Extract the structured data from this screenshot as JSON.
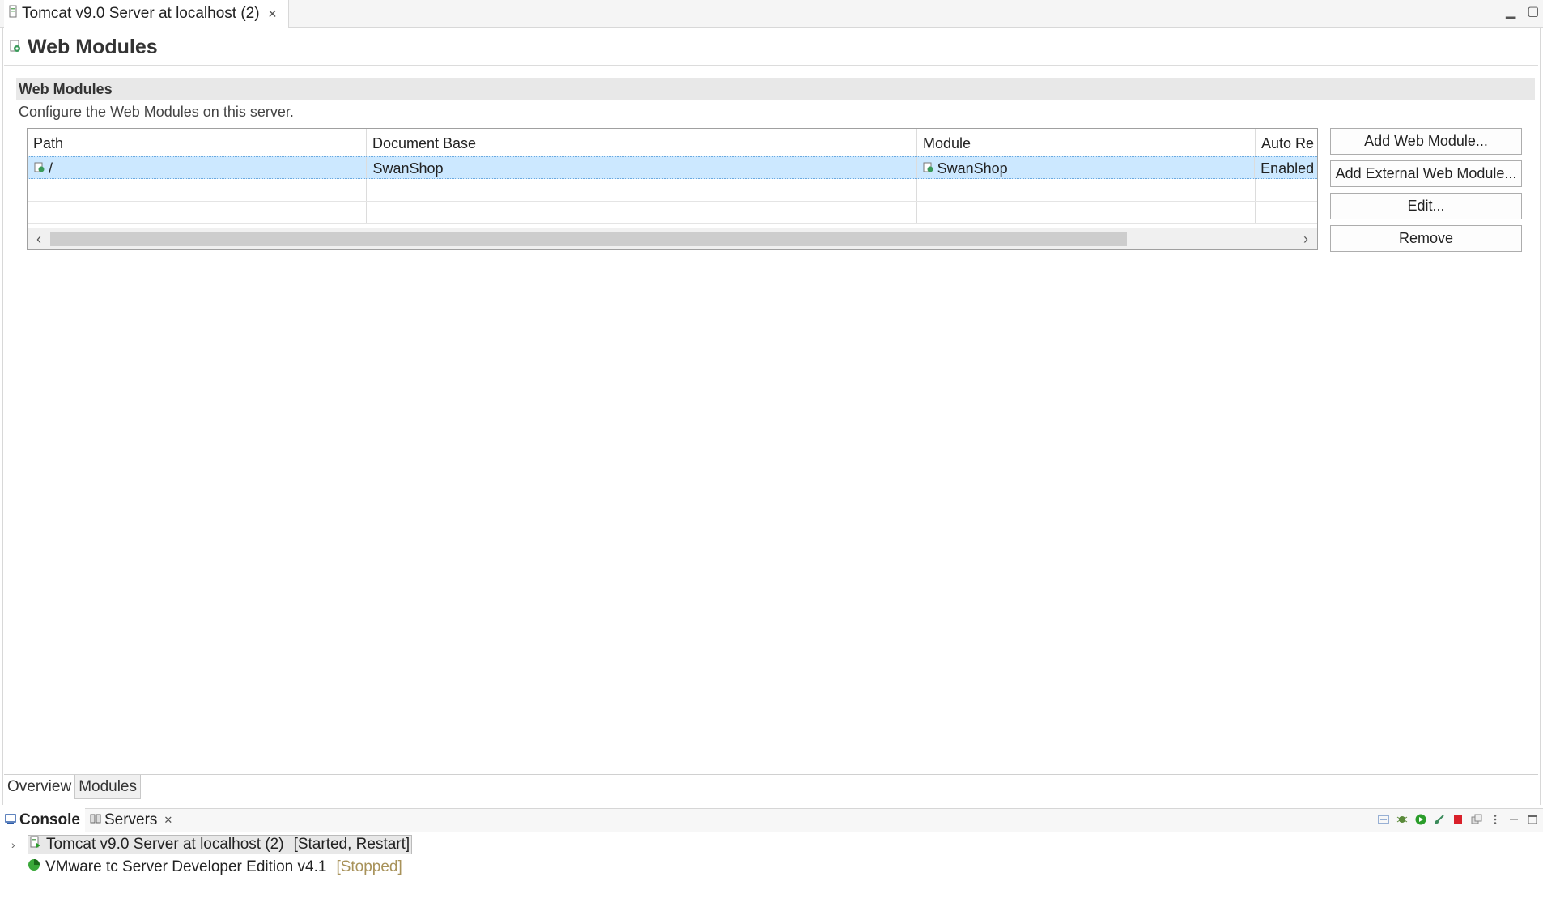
{
  "editor": {
    "tab_title": "Tomcat v9.0 Server at localhost (2)",
    "page_title": "Web Modules",
    "section_title": "Web Modules",
    "section_description": "Configure the Web Modules on this server.",
    "table": {
      "columns": [
        "Path",
        "Document Base",
        "Module",
        "Auto Re"
      ],
      "rows": [
        {
          "path": "/",
          "document_base": "SwanShop",
          "module": "SwanShop",
          "auto_reload": "Enabled",
          "selected": true
        }
      ]
    },
    "buttons": {
      "add_web_module": "Add Web Module...",
      "add_external_web_module": "Add External Web Module...",
      "edit": "Edit...",
      "remove": "Remove"
    },
    "bottom_tabs": [
      "Overview",
      "Modules"
    ],
    "active_bottom_tab": "Modules"
  },
  "view": {
    "tabs": [
      {
        "label": "Console",
        "active": true
      },
      {
        "label": "Servers",
        "active": false
      }
    ],
    "servers": [
      {
        "name": "Tomcat v9.0 Server at localhost (2)",
        "status": "[Started, Restart]",
        "selected": true
      },
      {
        "name": "VMware tc Server Developer Edition v4.1",
        "status": "[Stopped]",
        "selected": false
      }
    ]
  },
  "colors": {
    "selection": "#cce8ff",
    "section_header": "#e8e8e8",
    "stopped_status": "#a8925a",
    "start_green": "#2a9d2a",
    "stop_red": "#d9202a"
  }
}
